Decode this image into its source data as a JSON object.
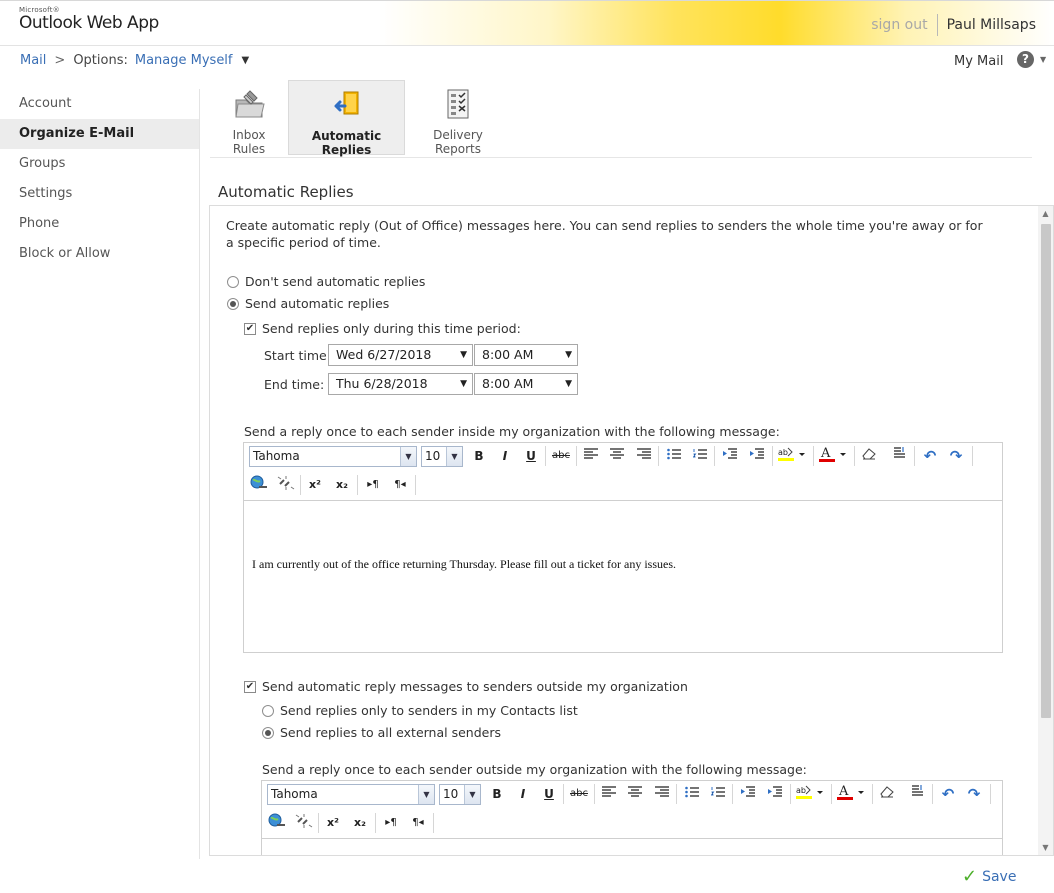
{
  "app": {
    "logo_small": "Microsoft®",
    "logo_main": "Outlook Web App",
    "sign_out": "sign out",
    "user_name": "Paul Millsaps"
  },
  "breadcrumb": {
    "mail": "Mail",
    "separator": ">",
    "options": "Options:",
    "current": "Manage Myself",
    "caret": "▼"
  },
  "top_right": {
    "my_mail": "My Mail",
    "help": "?",
    "help_caret": "▼"
  },
  "nav": {
    "items": [
      "Account",
      "Organize E-Mail",
      "Groups",
      "Settings",
      "Phone",
      "Block or Allow"
    ],
    "active": "Organize E-Mail"
  },
  "tabs": [
    {
      "label": "Inbox Rules",
      "icon": "inbox-rules-icon"
    },
    {
      "label": "Automatic Replies",
      "icon": "automatic-replies-icon"
    },
    {
      "label": "Delivery Reports",
      "icon": "delivery-reports-icon"
    }
  ],
  "active_tab": "Automatic Replies",
  "section": {
    "title": "Automatic Replies",
    "intro": "Create automatic reply (Out of Office) messages here. You can send replies to senders the whole time you're away or for a specific period of time."
  },
  "options": {
    "dont_send": "Don't send automatic replies",
    "send": "Send automatic replies",
    "selected": "send",
    "time_period_label": "Send replies only during this time period:",
    "time_period_checked": true,
    "start_label": "Start time:",
    "start_date": "Wed 6/27/2018",
    "start_time": "8:00 AM",
    "end_label": "End time:",
    "end_date": "Thu 6/28/2018",
    "end_time": "8:00 AM"
  },
  "inside": {
    "label": "Send a reply once to each sender inside my organization with the following message:",
    "font": "Tahoma",
    "size": "10",
    "message": "I am currently out of the office returning Thursday.  Please fill out a ticket for any issues."
  },
  "outside": {
    "enable_label": "Send automatic reply messages to senders outside my organization",
    "enabled": true,
    "contacts_only": "Send replies only to senders in my Contacts list",
    "all_external": "Send replies to all external senders",
    "selected": "all_external",
    "label": "Send a reply once to each sender outside my organization with the following message:",
    "font": "Tahoma",
    "size": "10"
  },
  "toolbar_glyphs": {
    "bold": "B",
    "italic": "I",
    "underline": "U",
    "strike": "abc",
    "superscript": "x²",
    "subscript": "x₂",
    "ltr": "▸¶",
    "rtl": "¶◂",
    "undo": "↶",
    "redo": "↷",
    "dd_arrow": "▼"
  },
  "footer": {
    "save": "Save",
    "save_check": "✓"
  },
  "colors": {
    "link": "#3a6fb5",
    "accent_yellow": "#ffdc2b",
    "font_color_bar": "#e00000",
    "highlight_bar": "#ffff00"
  }
}
